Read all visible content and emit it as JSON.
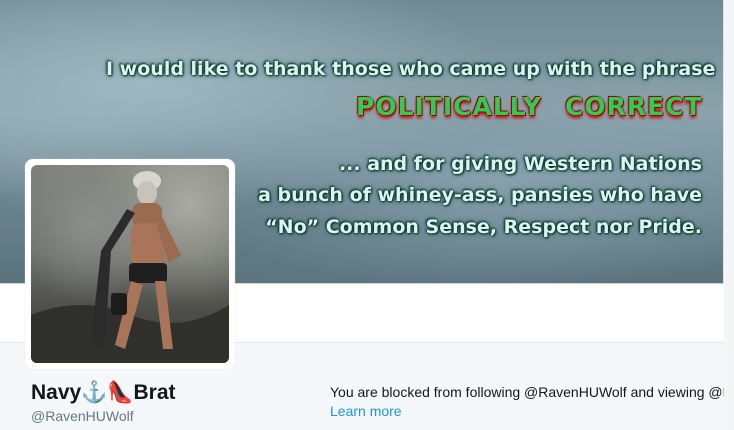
{
  "banner": {
    "line1": "I would like to thank those who came up with the phrase",
    "phrase_word1": "POLITICALLY",
    "phrase_word2": "CORRECT",
    "line3": "... and for giving Western Nations",
    "line4": "a bunch of whiney-ass, pansies who have",
    "line5": "“No” Common Sense, Respect nor Pride."
  },
  "profile": {
    "name_part1": "Navy",
    "name_icon1": "anchor-icon",
    "name_icon1_glyph": "⚓",
    "name_icon2": "high-heel-icon",
    "name_icon2_glyph": "👠",
    "name_part2": "Brat",
    "handle": "@RavenHUWolf"
  },
  "notice": {
    "blocked_text": "You are blocked from following @RavenHUWolf and viewing @R",
    "learn_more": "Learn more"
  }
}
